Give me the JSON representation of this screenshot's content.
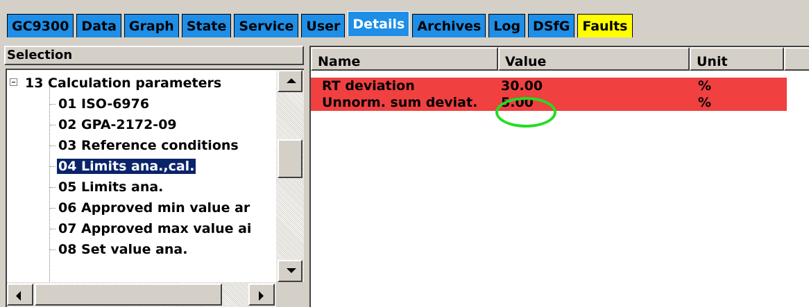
{
  "tabs": [
    {
      "label": "GC9300"
    },
    {
      "label": "Data"
    },
    {
      "label": "Graph"
    },
    {
      "label": "State"
    },
    {
      "label": "Service"
    },
    {
      "label": "User"
    },
    {
      "label": "Details"
    },
    {
      "label": "Archives"
    },
    {
      "label": "Log"
    },
    {
      "label": "DSfG"
    },
    {
      "label": "Faults"
    }
  ],
  "active_tab": "Details",
  "colors": {
    "tab_bg": "#1e8ee6",
    "faults_tab_bg": "#ffff00",
    "fault_row_bg": "#f04040",
    "selection_bg": "#0a246a",
    "highlight_ring": "#22dd22"
  },
  "selection": {
    "title": "Selection",
    "tree": [
      {
        "label": "13  Calculation parameters",
        "expanded": true
      },
      {
        "label": "01  ISO-6976"
      },
      {
        "label": "02  GPA-2172-09"
      },
      {
        "label": "03  Reference conditions"
      },
      {
        "label": "04  Limits ana.,cal.",
        "selected": true
      },
      {
        "label": "05  Limits ana."
      },
      {
        "label": "06  Approved min value ar"
      },
      {
        "label": "07  Approved max value ai"
      },
      {
        "label": "08  Set value ana."
      }
    ]
  },
  "details": {
    "columns": [
      "Name",
      "Value",
      "Unit"
    ],
    "rows": [
      {
        "name": "RT deviation",
        "value": "30.00",
        "unit": "%"
      },
      {
        "name": "Unnorm. sum deviat.",
        "value": "5.00",
        "unit": "%",
        "circled": true
      }
    ]
  }
}
